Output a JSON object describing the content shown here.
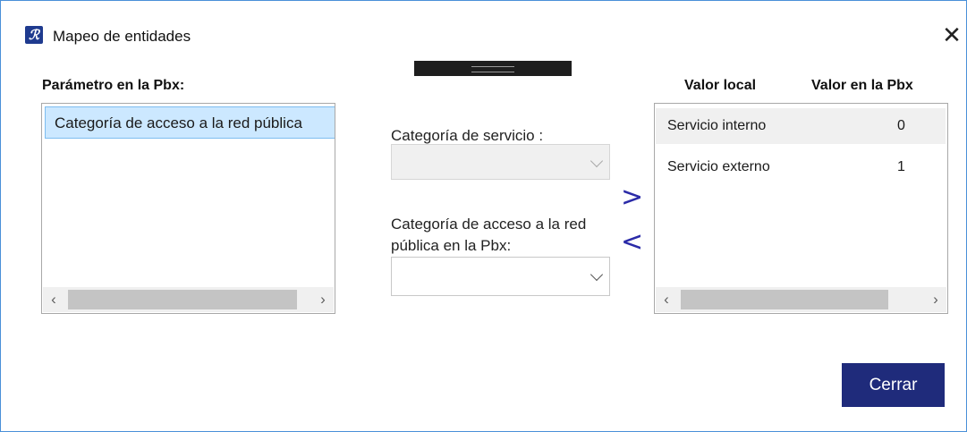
{
  "window": {
    "title": "Mapeo de entidades",
    "close_glyph": "✕"
  },
  "left_panel": {
    "heading": "Parámetro en la Pbx:",
    "items": [
      {
        "label": "Categoría de acceso a la red pública"
      }
    ]
  },
  "middle": {
    "service_label": "Categoría de servicio :",
    "service_value": "",
    "pbx_label_line1": "Categoría de acceso a la red",
    "pbx_label_line2": "pública en la Pbx:",
    "pbx_value": "",
    "move_right_glyph": ">",
    "move_left_glyph": "<"
  },
  "right_panel": {
    "columns": [
      "Valor local",
      "Valor en la Pbx"
    ],
    "rows": [
      {
        "local": "Servicio interno",
        "pbx": "0"
      },
      {
        "local": "Servicio externo",
        "pbx": "1"
      }
    ]
  },
  "scroll_arrows": {
    "left": "‹",
    "right": "›"
  },
  "footer": {
    "close_button": "Cerrar"
  },
  "colors": {
    "accent": "#1f2b7b",
    "selection": "#cce8ff",
    "window_border": "#4a90d9",
    "arrow_blue": "#2b2ba8"
  },
  "icons": [
    "app-logo-icon",
    "close-icon",
    "chevron-down-icon",
    "scroll-left-icon",
    "scroll-right-icon"
  ]
}
